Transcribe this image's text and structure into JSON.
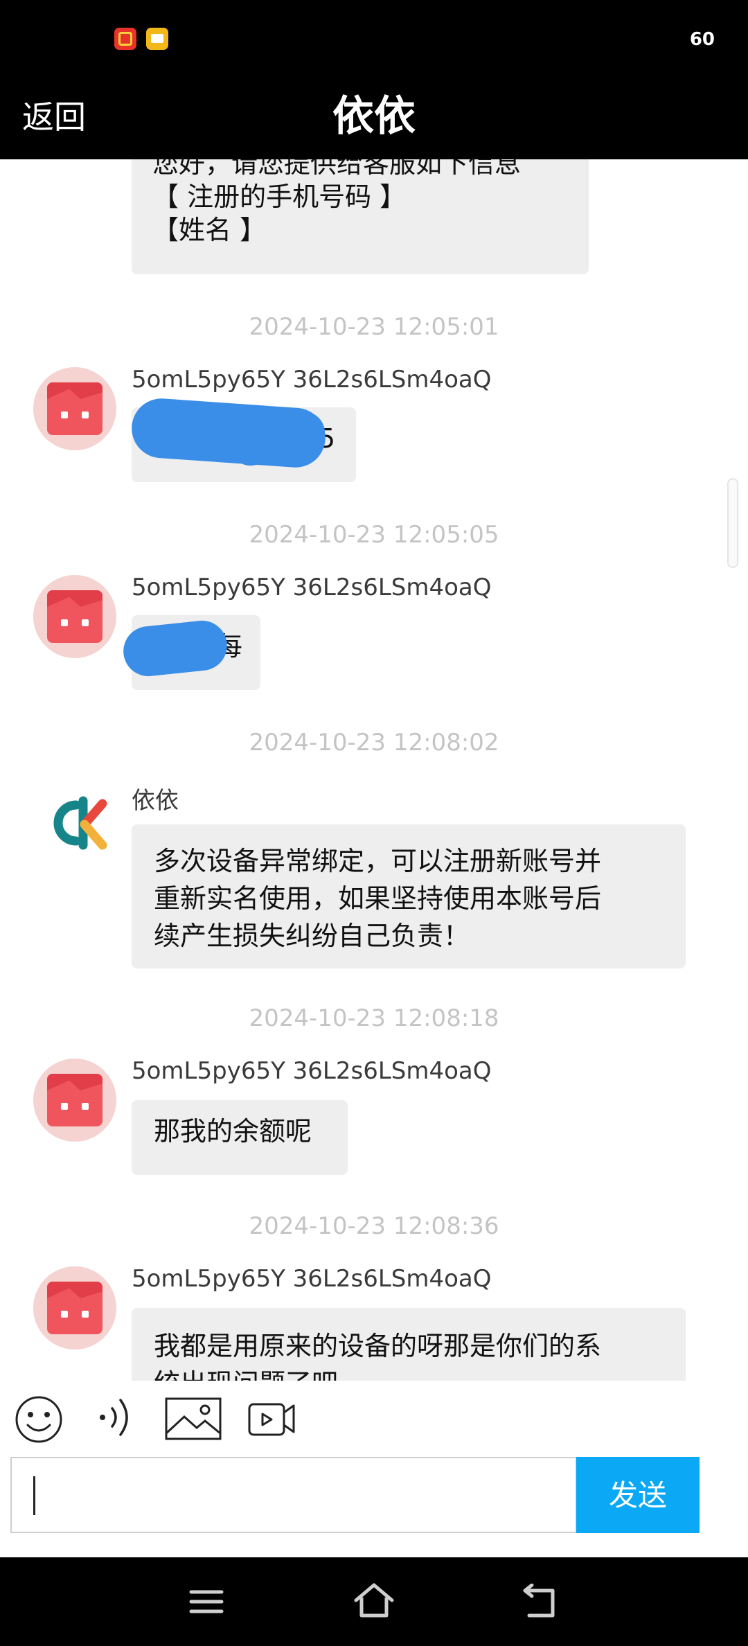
{
  "status_bar": {
    "battery": "60"
  },
  "header": {
    "back_label": "返回",
    "title": "依依"
  },
  "messages": [
    {
      "lines": [
        "您好，请您提供给客服如下信息",
        "【 注册的手机号码 】",
        "【姓名 】"
      ]
    },
    {
      "timestamp": "2024-10-23 12:05:01",
      "sender": "5omL5py65Y 36L2s6LSm4oaQ",
      "partial": "5"
    },
    {
      "timestamp": "2024-10-23 12:05:05",
      "sender": "5omL5py65Y 36L2s6LSm4oaQ",
      "partial": "每"
    },
    {
      "timestamp": "2024-10-23 12:08:02",
      "sender": "依依",
      "lines": [
        "多次设备异常绑定，可以注册新账号并",
        "重新实名使用，如果坚持使用本账号后",
        "续产生损失纠纷自己负责！"
      ]
    },
    {
      "timestamp": "2024-10-23 12:08:18",
      "sender": "5omL5py65Y 36L2s6LSm4oaQ",
      "text": "那我的余额呢"
    },
    {
      "timestamp": "2024-10-23 12:08:36",
      "sender": "5omL5py65Y 36L2s6LSm4oaQ",
      "lines": [
        "我都是用原来的设备的呀那是你们的系",
        "统出现问题了吧"
      ]
    }
  ],
  "composer": {
    "value": "",
    "send_label": "发送"
  },
  "icons": [
    "emoji-icon",
    "voice-icon",
    "image-icon",
    "video-icon",
    "menu-icon",
    "home-icon",
    "back-icon"
  ]
}
